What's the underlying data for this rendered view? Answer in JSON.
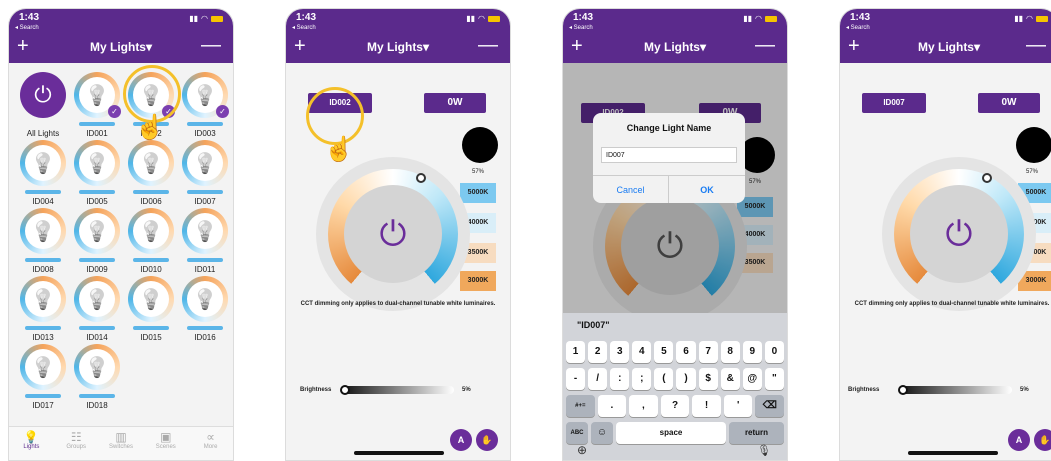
{
  "status": {
    "time": "1:43",
    "back": "◂ Search"
  },
  "header": {
    "plus": "+",
    "title": "My Lights▾",
    "minus": "—"
  },
  "grid": {
    "all_label": "All Lights",
    "items": [
      "ID001",
      "ID002",
      "ID003",
      "ID004",
      "ID005",
      "ID006",
      "ID007",
      "ID008",
      "ID009",
      "ID010",
      "ID011",
      "ID013",
      "ID014",
      "ID015",
      "ID016",
      "ID017",
      "ID018"
    ]
  },
  "tabs": [
    "Lights",
    "Groups",
    "Switches",
    "Scenes",
    "More"
  ],
  "screen2": {
    "name": "ID002",
    "power": "0W",
    "percent": "57%",
    "note": "CCT dimming only applies to dual-channel tunable white luminaires.",
    "brightness_label": "Brightness",
    "brightness_value": "5%"
  },
  "screen3": {
    "name_behind": "ID002",
    "power_behind": "0W",
    "percent": "57%",
    "dialog_title": "Change Light Name",
    "dialog_input": "ID007",
    "cancel": "Cancel",
    "ok": "OK",
    "suggestion": "\"ID007\""
  },
  "screen4": {
    "name": "ID007",
    "power": "0W",
    "percent": "57%",
    "note": "CCT dimming only applies to dual-channel tunable white luminaires.",
    "brightness_label": "Brightness",
    "brightness_value": "5%"
  },
  "cct": [
    "5000K",
    "4000K",
    "3500K",
    "3000K"
  ],
  "cct_colors": {
    "5000K": "#7cc9f0",
    "4000K": "#d9eef8",
    "3500K": "#f7dcc0",
    "3000K": "#f0a85c"
  },
  "keyboard": {
    "row1": [
      "1",
      "2",
      "3",
      "4",
      "5",
      "6",
      "7",
      "8",
      "9",
      "0"
    ],
    "row2": [
      "-",
      "/",
      ":",
      ";",
      "(",
      ")",
      "$",
      "&",
      "@",
      "\""
    ],
    "row3": [
      "#+=",
      ".",
      ",",
      "?",
      "!",
      "'",
      "⌫"
    ],
    "row4": [
      "ABC",
      "☺",
      "space",
      "return"
    ]
  },
  "fab": {
    "a": "A",
    "b": "✋"
  }
}
